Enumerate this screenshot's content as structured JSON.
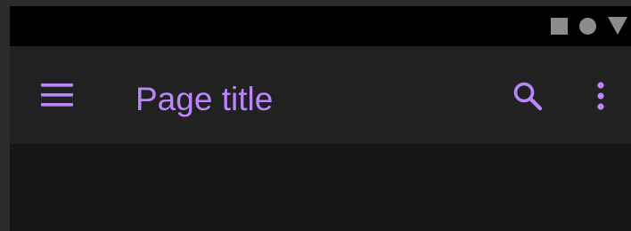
{
  "status_bar": {
    "icons": [
      "stop-square-icon",
      "circle-icon",
      "triangle-down-icon"
    ],
    "icon_color": "#8c8c8c"
  },
  "app_bar": {
    "title": "Page title",
    "navigation_icon": "menu-icon",
    "actions": [
      "search-icon",
      "more-vert-icon"
    ],
    "accent_color": "#bb86fc",
    "background": "#212121"
  },
  "theme": {
    "content_background": "#161616",
    "status_background": "#000000"
  }
}
